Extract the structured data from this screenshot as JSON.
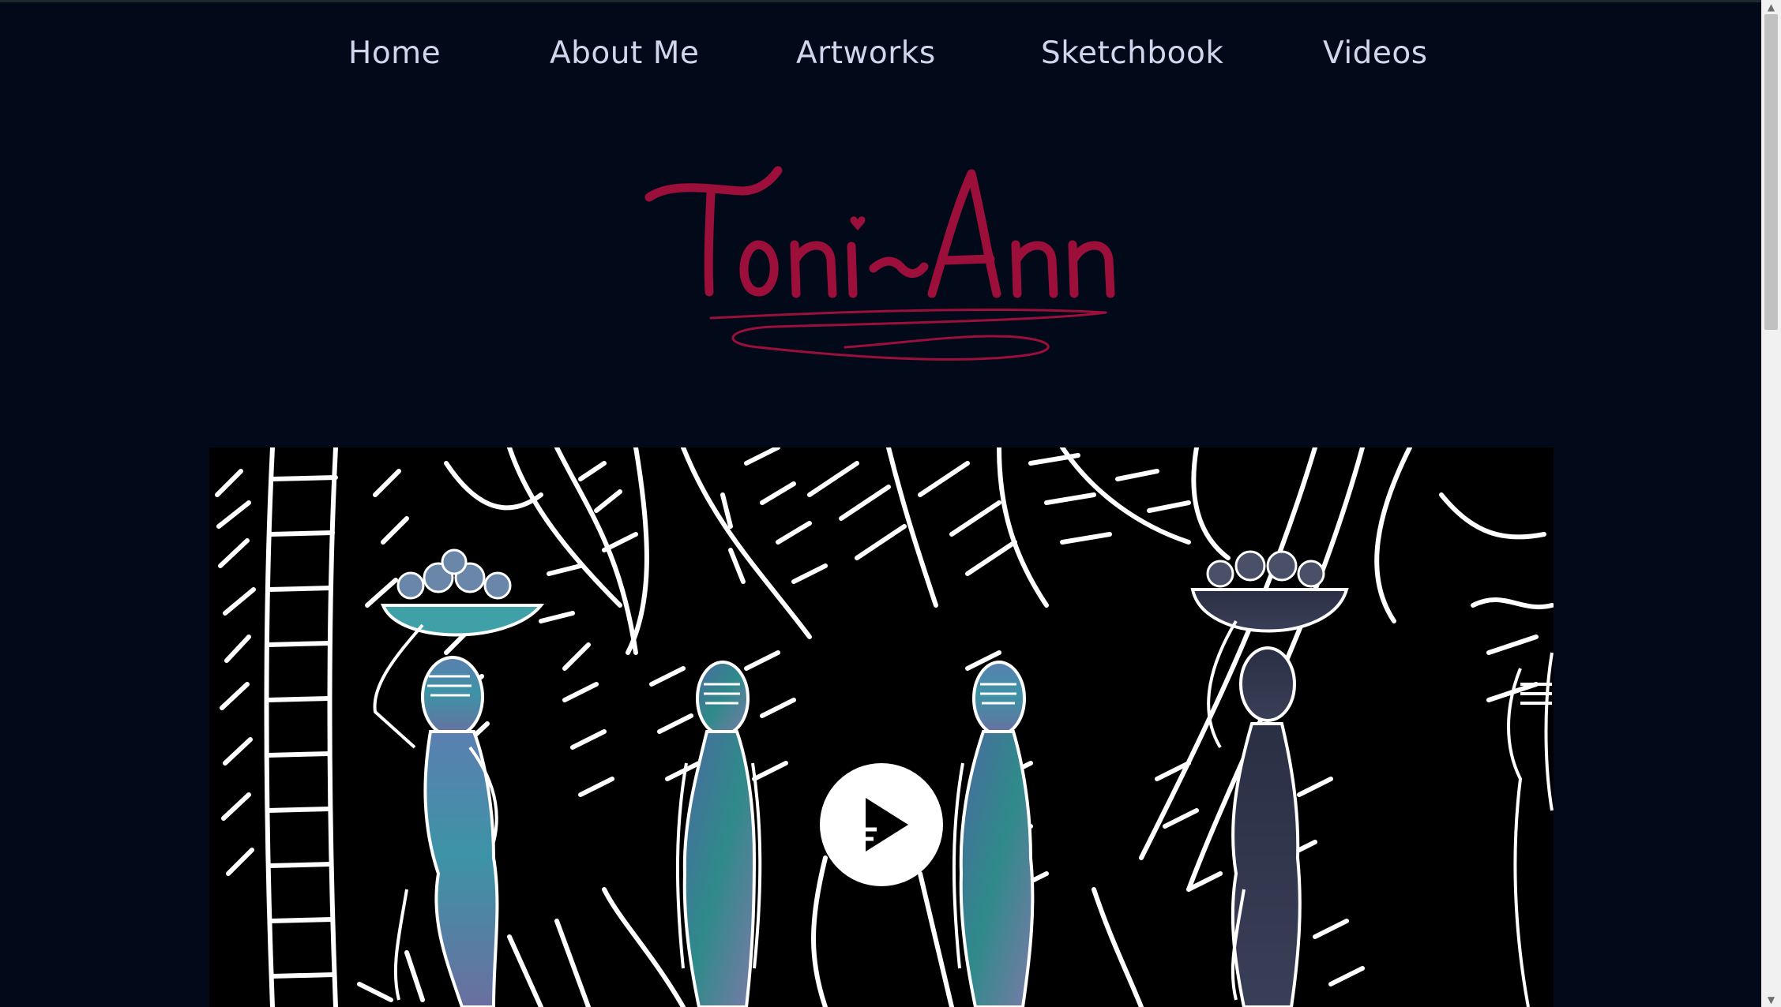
{
  "nav": {
    "items": [
      {
        "label": "Home"
      },
      {
        "label": "About Me"
      },
      {
        "label": "Artworks"
      },
      {
        "label": "Sketchbook"
      },
      {
        "label": "Videos"
      }
    ]
  },
  "logo": {
    "text": "Toni-Ann",
    "color": "#9b0f3a"
  },
  "video": {
    "play_icon": "play-icon"
  },
  "colors": {
    "background": "#020919",
    "nav_text": "#cfd6ee",
    "accent": "#9b0f3a"
  },
  "scrollbar": {
    "up_glyph": "▲",
    "down_glyph": "▼"
  }
}
